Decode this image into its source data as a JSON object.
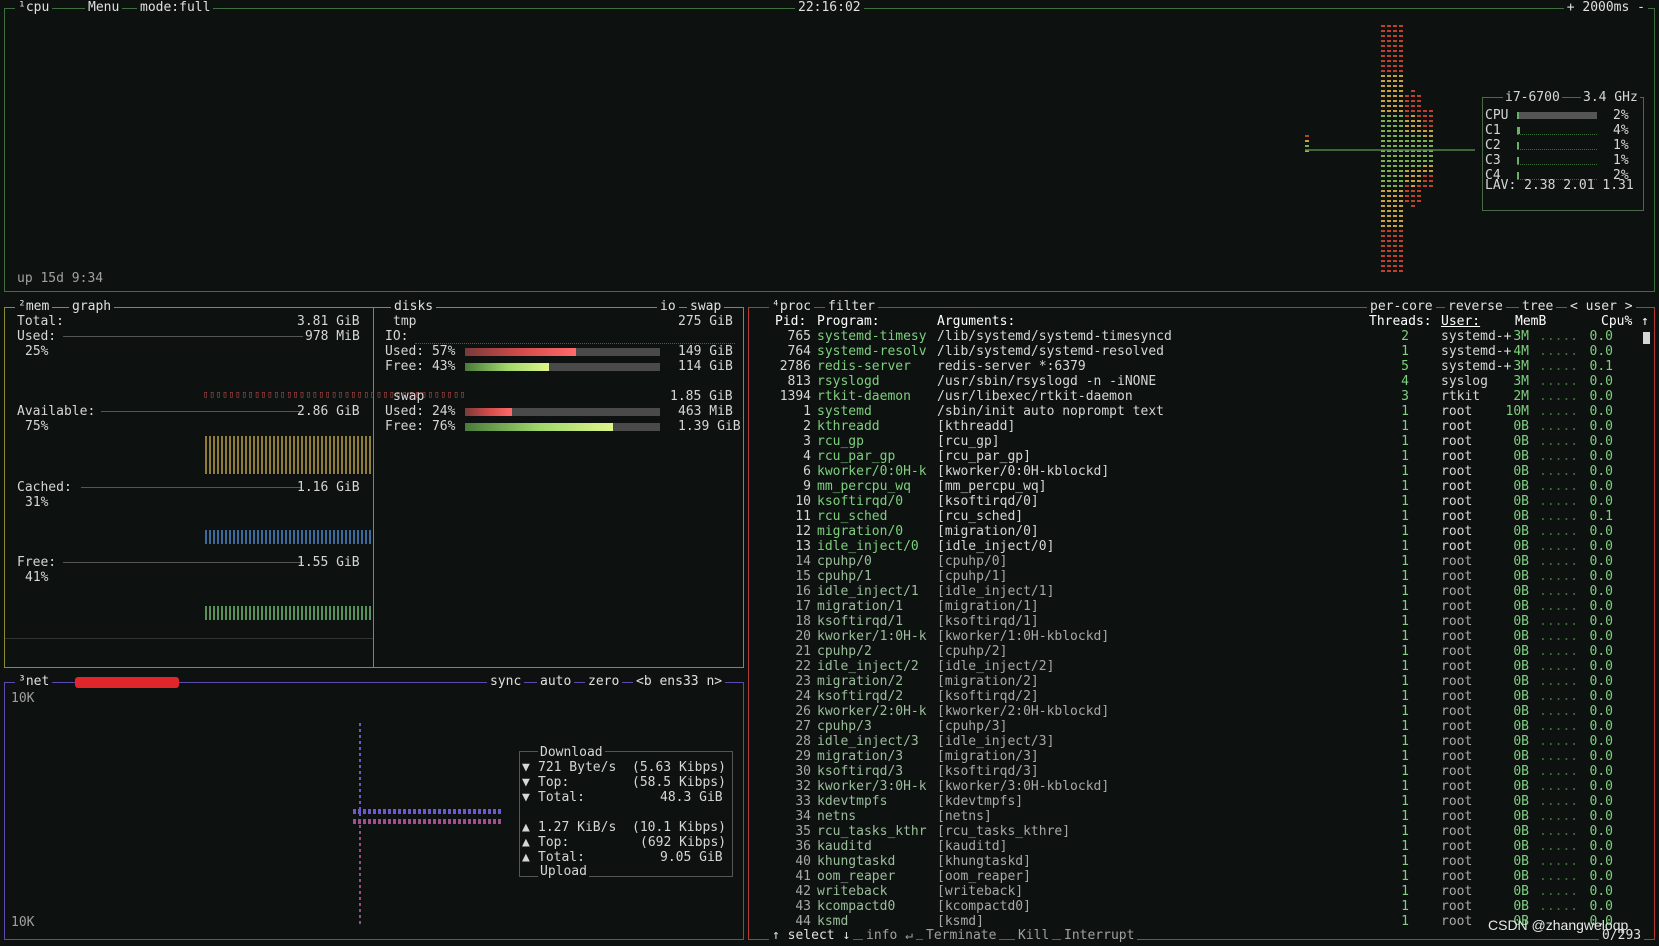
{
  "colors": {
    "cpu_border": "#3f6f3f",
    "mem_border": "#8a8a30",
    "net_border": "#5b4bb0",
    "proc_border": "#b03a3a",
    "accent_green": "#7ed07e",
    "bar_red": "#d24b4b",
    "bar_green": "#9fd66a"
  },
  "cpu": {
    "tab_num": "¹",
    "tab": "cpu",
    "menu": "Menu",
    "mode": "mode:full",
    "clock": "22:16:02",
    "interval": "+ 2000ms -",
    "model": "i7-6700",
    "freq": "3.4 GHz",
    "rows": [
      {
        "label": "CPU",
        "pct": "2%",
        "fill": 0.02
      },
      {
        "label": "C1",
        "pct": "4%",
        "fill": 0.04
      },
      {
        "label": "C2",
        "pct": "1%",
        "fill": 0.01
      },
      {
        "label": "C3",
        "pct": "1%",
        "fill": 0.01
      },
      {
        "label": "C4",
        "pct": "2%",
        "fill": 0.02
      }
    ],
    "lav": "LAV: 2.38 2.01 1.31",
    "uptime": "up 15d 9:34"
  },
  "mem": {
    "tab_num": "²",
    "tab": "mem",
    "graph": "graph",
    "disks": "disks",
    "io": "io",
    "swap": "swap",
    "total_label": "Total:",
    "total": "3.81 GiB",
    "used_label": "Used:",
    "used": "978 MiB",
    "used_pct": "25%",
    "available_label": "Available:",
    "available": "2.86 GiB",
    "available_pct": "75%",
    "cached_label": "Cached:",
    "cached": "1.16 GiB",
    "cached_pct": "31%",
    "free_label": "Free:",
    "free": "1.55 GiB",
    "free_pct": "41%"
  },
  "disks": {
    "tmp_name": "tmp",
    "tmp_size": "275 GiB",
    "io_label": "IO:",
    "tmp_used_label": "Used: 57%",
    "tmp_used": "149 GiB",
    "tmp_used_fill": 0.57,
    "tmp_free_label": "Free: 43%",
    "tmp_free": "114 GiB",
    "tmp_free_fill": 0.43,
    "swap_name": "swap",
    "swap_size": "1.85 GiB",
    "swap_used_label": "Used: 24%",
    "swap_used": "463 MiB",
    "swap_used_fill": 0.24,
    "swap_free_label": "Free: 76%",
    "swap_free": "1.39 GiB",
    "swap_free_fill": 0.76
  },
  "net": {
    "tab_num": "³",
    "tab": "net",
    "sync": "sync",
    "auto": "auto",
    "zero": "zero",
    "iface": "<b ens33 n>",
    "scale_top": "10K",
    "scale_bottom": "10K",
    "download_title": "Download",
    "dl_rate": "721 Byte/s",
    "dl_rate_bits": "(5.63 Kibps)",
    "dl_top_label": "Top:",
    "dl_top": "(58.5 Kibps)",
    "dl_total_label": "Total:",
    "dl_total": "48.3 GiB",
    "up_rate": "1.27 KiB/s",
    "up_rate_bits": "(10.1 Kibps)",
    "up_top_label": "Top:",
    "up_top": "(692 Kibps)",
    "up_total_label": "Total:",
    "up_total": "9.05 GiB",
    "upload_title": "Upload",
    "down_arrow": "▼",
    "up_arrow": "▲"
  },
  "proc": {
    "tab_num": "⁴",
    "tab": "proc",
    "filter": "filter",
    "per_core": "per-core",
    "reverse": "reverse",
    "tree": "tree",
    "sort": "< user >",
    "headers": {
      "pid": "Pid:",
      "program": "Program:",
      "args": "Arguments:",
      "threads": "Threads:",
      "user": "User:",
      "mem": "MemB",
      "cpu": "Cpu%"
    },
    "sort_arrow": "↑",
    "rows": [
      {
        "pid": "765",
        "prog": "systemd-timesy",
        "args": "/lib/systemd/systemd-timesyncd",
        "thr": "2",
        "user": "systemd-+",
        "mem": "3M",
        "cpu": "0.0",
        "hi": true
      },
      {
        "pid": "764",
        "prog": "systemd-resolv",
        "args": "/lib/systemd/systemd-resolved",
        "thr": "1",
        "user": "systemd-+",
        "mem": "4M",
        "cpu": "0.0",
        "hi": true
      },
      {
        "pid": "2786",
        "prog": "redis-server",
        "args": "redis-server *:6379",
        "thr": "5",
        "user": "systemd-+",
        "mem": "3M",
        "cpu": "0.1",
        "hi": true
      },
      {
        "pid": "813",
        "prog": "rsyslogd",
        "args": "/usr/sbin/rsyslogd -n -iNONE",
        "thr": "4",
        "user": "syslog",
        "mem": "3M",
        "cpu": "0.0",
        "hi": true
      },
      {
        "pid": "1394",
        "prog": "rtkit-daemon",
        "args": "/usr/libexec/rtkit-daemon",
        "thr": "3",
        "user": "rtkit",
        "mem": "2M",
        "cpu": "0.0",
        "hi": true
      },
      {
        "pid": "1",
        "prog": "systemd",
        "args": "/sbin/init auto noprompt text",
        "thr": "1",
        "user": "root",
        "mem": "10M",
        "cpu": "0.0",
        "hi": true
      },
      {
        "pid": "2",
        "prog": "kthreadd",
        "args": "[kthreadd]",
        "thr": "1",
        "user": "root",
        "mem": "0B",
        "cpu": "0.0",
        "hi": true
      },
      {
        "pid": "3",
        "prog": "rcu_gp",
        "args": "[rcu_gp]",
        "thr": "1",
        "user": "root",
        "mem": "0B",
        "cpu": "0.0",
        "hi": true
      },
      {
        "pid": "4",
        "prog": "rcu_par_gp",
        "args": "[rcu_par_gp]",
        "thr": "1",
        "user": "root",
        "mem": "0B",
        "cpu": "0.0",
        "hi": true
      },
      {
        "pid": "6",
        "prog": "kworker/0:0H-k",
        "args": "[kworker/0:0H-kblockd]",
        "thr": "1",
        "user": "root",
        "mem": "0B",
        "cpu": "0.0",
        "hi": true
      },
      {
        "pid": "9",
        "prog": "mm_percpu_wq",
        "args": "[mm_percpu_wq]",
        "thr": "1",
        "user": "root",
        "mem": "0B",
        "cpu": "0.0",
        "hi": true
      },
      {
        "pid": "10",
        "prog": "ksoftirqd/0",
        "args": "[ksoftirqd/0]",
        "thr": "1",
        "user": "root",
        "mem": "0B",
        "cpu": "0.0",
        "hi": true
      },
      {
        "pid": "11",
        "prog": "rcu_sched",
        "args": "[rcu_sched]",
        "thr": "1",
        "user": "root",
        "mem": "0B",
        "cpu": "0.1",
        "hi": true
      },
      {
        "pid": "12",
        "prog": "migration/0",
        "args": "[migration/0]",
        "thr": "1",
        "user": "root",
        "mem": "0B",
        "cpu": "0.0",
        "hi": true
      },
      {
        "pid": "13",
        "prog": "idle_inject/0",
        "args": "[idle_inject/0]",
        "thr": "1",
        "user": "root",
        "mem": "0B",
        "cpu": "0.0",
        "hi": true
      },
      {
        "pid": "14",
        "prog": "cpuhp/0",
        "args": "[cpuhp/0]",
        "thr": "1",
        "user": "root",
        "mem": "0B",
        "cpu": "0.0",
        "hi": false
      },
      {
        "pid": "15",
        "prog": "cpuhp/1",
        "args": "[cpuhp/1]",
        "thr": "1",
        "user": "root",
        "mem": "0B",
        "cpu": "0.0",
        "hi": false
      },
      {
        "pid": "16",
        "prog": "idle_inject/1",
        "args": "[idle_inject/1]",
        "thr": "1",
        "user": "root",
        "mem": "0B",
        "cpu": "0.0",
        "hi": false
      },
      {
        "pid": "17",
        "prog": "migration/1",
        "args": "[migration/1]",
        "thr": "1",
        "user": "root",
        "mem": "0B",
        "cpu": "0.0",
        "hi": false
      },
      {
        "pid": "18",
        "prog": "ksoftirqd/1",
        "args": "[ksoftirqd/1]",
        "thr": "1",
        "user": "root",
        "mem": "0B",
        "cpu": "0.0",
        "hi": false
      },
      {
        "pid": "20",
        "prog": "kworker/1:0H-k",
        "args": "[kworker/1:0H-kblockd]",
        "thr": "1",
        "user": "root",
        "mem": "0B",
        "cpu": "0.0",
        "hi": false
      },
      {
        "pid": "21",
        "prog": "cpuhp/2",
        "args": "[cpuhp/2]",
        "thr": "1",
        "user": "root",
        "mem": "0B",
        "cpu": "0.0",
        "hi": false
      },
      {
        "pid": "22",
        "prog": "idle_inject/2",
        "args": "[idle_inject/2]",
        "thr": "1",
        "user": "root",
        "mem": "0B",
        "cpu": "0.0",
        "hi": false
      },
      {
        "pid": "23",
        "prog": "migration/2",
        "args": "[migration/2]",
        "thr": "1",
        "user": "root",
        "mem": "0B",
        "cpu": "0.0",
        "hi": false
      },
      {
        "pid": "24",
        "prog": "ksoftirqd/2",
        "args": "[ksoftirqd/2]",
        "thr": "1",
        "user": "root",
        "mem": "0B",
        "cpu": "0.0",
        "hi": false
      },
      {
        "pid": "26",
        "prog": "kworker/2:0H-k",
        "args": "[kworker/2:0H-kblockd]",
        "thr": "1",
        "user": "root",
        "mem": "0B",
        "cpu": "0.0",
        "hi": false
      },
      {
        "pid": "27",
        "prog": "cpuhp/3",
        "args": "[cpuhp/3]",
        "thr": "1",
        "user": "root",
        "mem": "0B",
        "cpu": "0.0",
        "hi": false
      },
      {
        "pid": "28",
        "prog": "idle_inject/3",
        "args": "[idle_inject/3]",
        "thr": "1",
        "user": "root",
        "mem": "0B",
        "cpu": "0.0",
        "hi": false
      },
      {
        "pid": "29",
        "prog": "migration/3",
        "args": "[migration/3]",
        "thr": "1",
        "user": "root",
        "mem": "0B",
        "cpu": "0.0",
        "hi": false
      },
      {
        "pid": "30",
        "prog": "ksoftirqd/3",
        "args": "[ksoftirqd/3]",
        "thr": "1",
        "user": "root",
        "mem": "0B",
        "cpu": "0.0",
        "hi": false
      },
      {
        "pid": "32",
        "prog": "kworker/3:0H-k",
        "args": "[kworker/3:0H-kblockd]",
        "thr": "1",
        "user": "root",
        "mem": "0B",
        "cpu": "0.0",
        "hi": false
      },
      {
        "pid": "33",
        "prog": "kdevtmpfs",
        "args": "[kdevtmpfs]",
        "thr": "1",
        "user": "root",
        "mem": "0B",
        "cpu": "0.0",
        "hi": false
      },
      {
        "pid": "34",
        "prog": "netns",
        "args": "[netns]",
        "thr": "1",
        "user": "root",
        "mem": "0B",
        "cpu": "0.0",
        "hi": false
      },
      {
        "pid": "35",
        "prog": "rcu_tasks_kthr",
        "args": "[rcu_tasks_kthre]",
        "thr": "1",
        "user": "root",
        "mem": "0B",
        "cpu": "0.0",
        "hi": false
      },
      {
        "pid": "36",
        "prog": "kauditd",
        "args": "[kauditd]",
        "thr": "1",
        "user": "root",
        "mem": "0B",
        "cpu": "0.0",
        "hi": false
      },
      {
        "pid": "40",
        "prog": "khungtaskd",
        "args": "[khungtaskd]",
        "thr": "1",
        "user": "root",
        "mem": "0B",
        "cpu": "0.0",
        "hi": false
      },
      {
        "pid": "41",
        "prog": "oom_reaper",
        "args": "[oom_reaper]",
        "thr": "1",
        "user": "root",
        "mem": "0B",
        "cpu": "0.0",
        "hi": false
      },
      {
        "pid": "42",
        "prog": "writeback",
        "args": "[writeback]",
        "thr": "1",
        "user": "root",
        "mem": "0B",
        "cpu": "0.0",
        "hi": false
      },
      {
        "pid": "43",
        "prog": "kcompactd0",
        "args": "[kcompactd0]",
        "thr": "1",
        "user": "root",
        "mem": "0B",
        "cpu": "0.0",
        "hi": false
      },
      {
        "pid": "44",
        "prog": "ksmd",
        "args": "[ksmd]",
        "thr": "1",
        "user": "root",
        "mem": "0B",
        "cpu": "0.0",
        "hi": false
      }
    ],
    "footer": {
      "select": "↑ select ↓",
      "info": "info ↵",
      "terminate": "Terminate",
      "kill": "Kill",
      "interrupt": "Interrupt",
      "count": "0/293"
    }
  },
  "watermark": "CSDN @zhangweloqp"
}
